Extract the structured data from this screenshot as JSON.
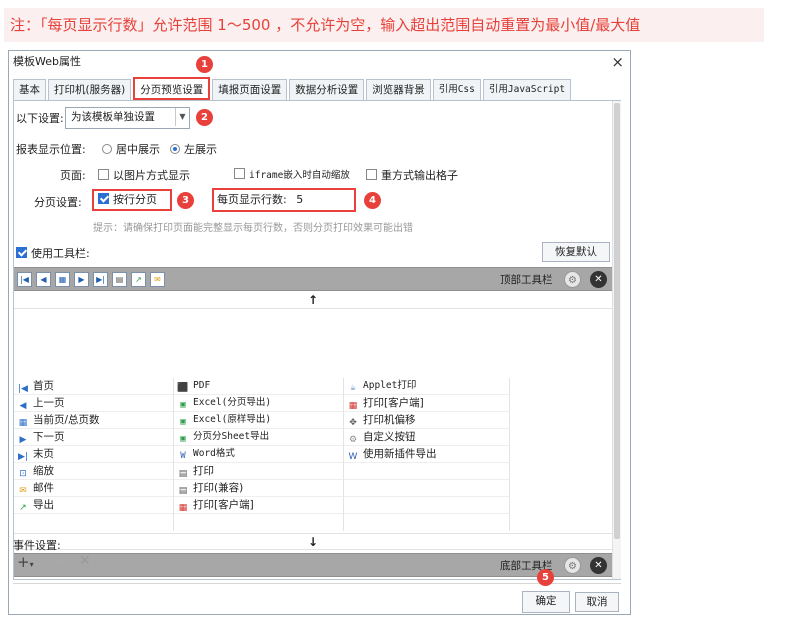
{
  "note": "注：「每页显示行数」允许范围 1～500 ，不允许为空，输入超出范围自动重置为最小值/最大值",
  "dialog": {
    "title": "模板Web属性",
    "close": "×",
    "tabs": [
      "基本",
      "打印机(服务器)",
      "分页预览设置",
      "填报页面设置",
      "数据分析设置",
      "浏览器背景",
      "引用Css",
      "引用JavaScript"
    ]
  },
  "settings": {
    "scope_label": "以下设置:",
    "scope_value": "为该模板单独设置",
    "display_pos_label": "报表显示位置:",
    "center_label": "居中展示",
    "left_label": "左展示",
    "page_label": "页面:",
    "img_mode_label": "以图片方式显示",
    "iframe_label": "iframe嵌入时自动缩放",
    "reexport_label": "重方式输出格子",
    "paging_label": "分页设置:",
    "by_row_label": "按行分页",
    "rows_label": "每页显示行数:",
    "rows_value": "5",
    "hint": "提示：请确保打印页面能完整显示每页行数，否则分页打印效果可能出错",
    "use_toolbar_label": "使用工具栏:",
    "restore_label": "恢复默认"
  },
  "toolbar": {
    "top_label": "顶部工具栏",
    "bottom_label": "底部工具栏",
    "up_arrow": "↑",
    "down_arrow": "↓"
  },
  "items": {
    "col1": [
      "首页",
      "上一页",
      "当前页/总页数",
      "下一页",
      "末页",
      "缩放",
      "邮件",
      "导出"
    ],
    "col2": [
      "PDF",
      "Excel(分页导出)",
      "Excel(原样导出)",
      "分页分Sheet导出",
      "Word格式",
      "打印",
      "打印(兼容)",
      "打印[客户端]"
    ],
    "col3": [
      "Applet打印",
      "打印[客户端]",
      "打印机偏移",
      "自定义按钮",
      "使用新插件导出"
    ]
  },
  "events": {
    "label": "事件设置:"
  },
  "buttons": {
    "ok": "确定",
    "cancel": "取消"
  },
  "badges": [
    "1",
    "2",
    "3",
    "4",
    "5"
  ],
  "colors": {
    "accent": "#e8403a",
    "note_bg": "#fbf0ef",
    "toolbar_bg": "#a7a7a7",
    "check": "#2a6fd1"
  }
}
